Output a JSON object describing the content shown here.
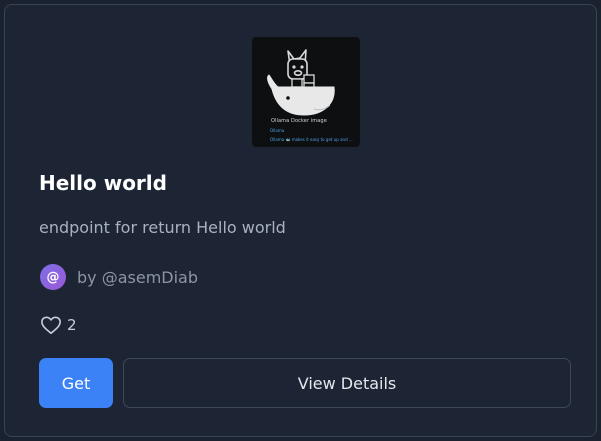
{
  "card": {
    "thumbnail": {
      "caption": "Ollama Docker image",
      "broken_image_alt": "Ollama",
      "link_text": "Ollama 🐳 makes it easy to get up and ..."
    },
    "title": "Hello world",
    "description": "endpoint for return Hello world",
    "author": {
      "avatar_symbol": "@",
      "byline": "by @asemDiab"
    },
    "likes": {
      "icon": "heart-outline-icon",
      "count": "2"
    },
    "actions": {
      "get_label": "Get",
      "view_details_label": "View Details"
    }
  },
  "colors": {
    "background": "#1a2230",
    "card": "#1d2535",
    "border": "#3a4353",
    "primary_button": "#3b82f6",
    "avatar_gradient_start": "#7c6ee6",
    "avatar_gradient_end": "#9b59d9"
  }
}
